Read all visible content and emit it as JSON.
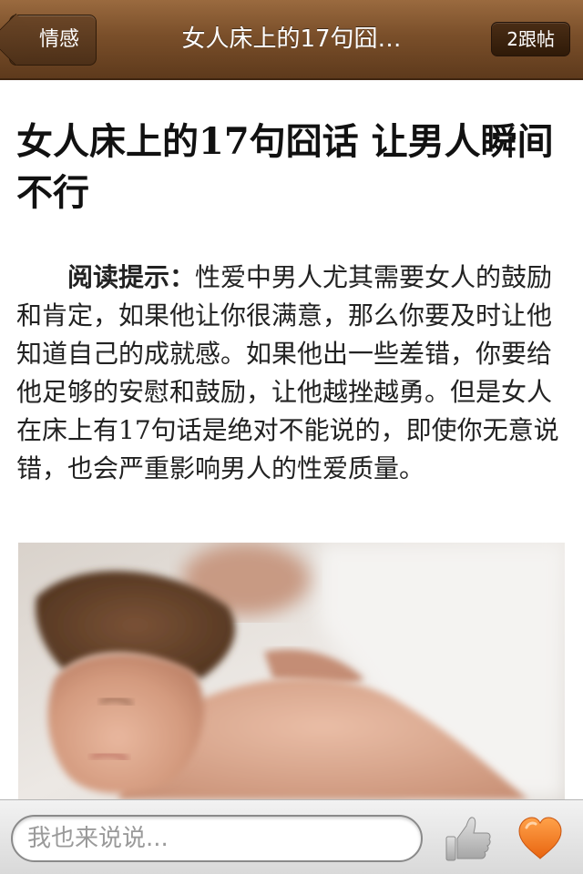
{
  "header": {
    "back_label": "情感",
    "title": "女人床上的17句囧…",
    "reply_count_label": "2跟帖"
  },
  "article": {
    "title": "女人床上的17句囧话 让男人瞬间不行",
    "summary_label": "阅读提示：",
    "summary_text": "性爱中男人尤其需要女人的鼓励和肯定，如果他让你很满意，那么你要及时让他知道自己的成就感。如果他出一些差错，你要给他足够的安慰和鼓励，让他越挫越勇。但是女人在床上有17句话是绝对不能说的，即使你无意说错，也会严重影响男人的性爱质量。"
  },
  "footer": {
    "comment_placeholder": "我也来说说...",
    "like_icon": "thumbs-up-icon",
    "favorite_icon": "heart-icon"
  },
  "colors": {
    "navbar": "#7a4f2a",
    "heart": "#f07a1e",
    "thumb": "#b8b8b8"
  }
}
